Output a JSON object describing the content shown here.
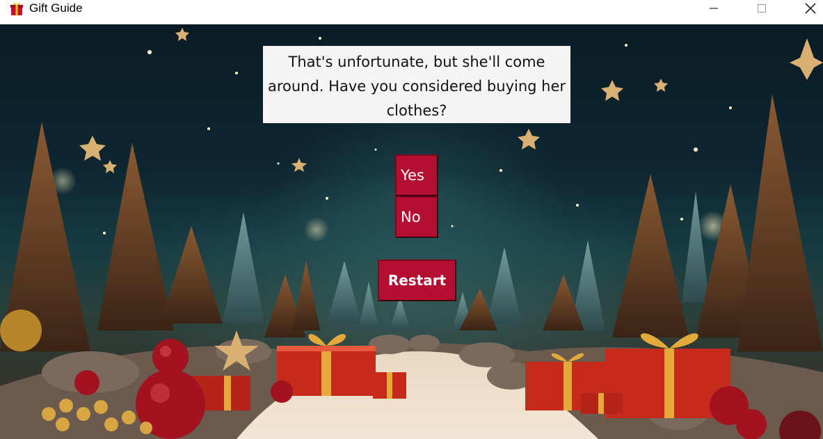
{
  "window": {
    "title": "Gift Guide",
    "icon": "gift-icon",
    "controls": [
      "minimize-icon",
      "maximize-icon",
      "close-icon"
    ]
  },
  "dialog": {
    "question": "That's unfortunate, but she'll come around. Have you considered buying her clothes?"
  },
  "buttons": {
    "yes": "Yes",
    "no": "No",
    "restart": "Restart"
  },
  "colors": {
    "button_bg": "#b40f32",
    "question_bg": "#f5f5f5"
  },
  "background": "christmas-forest-with-presents"
}
